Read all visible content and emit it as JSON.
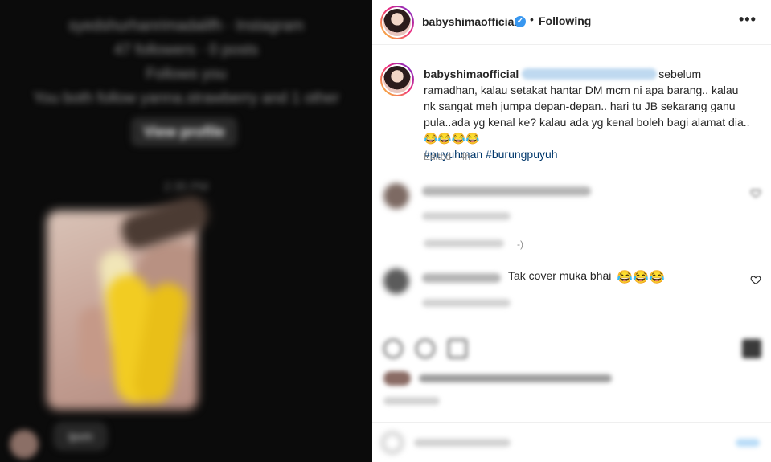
{
  "left_panel": {
    "profile_line_1": "syedshurhanrimadalifh · Instagram",
    "profile_line_2": "47 followers · 0 posts",
    "profile_line_3": "Follows you",
    "profile_line_4": "You both follow yanna.strawberry and 1 other",
    "view_profile_label": "View profile",
    "time_label": "2:35 PM",
    "bubble_text": "Ipvm"
  },
  "post": {
    "header": {
      "username": "babyshimaofficial",
      "verified_icon": "verified-badge-icon",
      "separator": "•",
      "following_label": "Following",
      "more_icon": "•••"
    },
    "caption": {
      "username": "babyshimaofficial",
      "text_1": "sebelum ramadhan, kalau setakat hantar DM mcm ni apa barang.. kalau nk sangat meh jumpa depan-depan.. hari tu JB sekarang ganu pula..ada yg kenal ke? kalau ada yg kenal boleh bagi alamat dia..",
      "emojis": "😂😂😂😂",
      "hashtags": "#puyuhman #burungpuyuh",
      "edited": "Edited · 4h"
    },
    "comments": [
      {
        "blurred": true,
        "reply_suffix": "-)"
      },
      {
        "blurred_user": true,
        "text": "Tak cover muka bhai",
        "emojis": "😂😂😂"
      }
    ],
    "colors": {
      "accent_blue": "#3897f0",
      "hashtag": "#00376b",
      "meta_gray": "#8e8e8e"
    }
  }
}
